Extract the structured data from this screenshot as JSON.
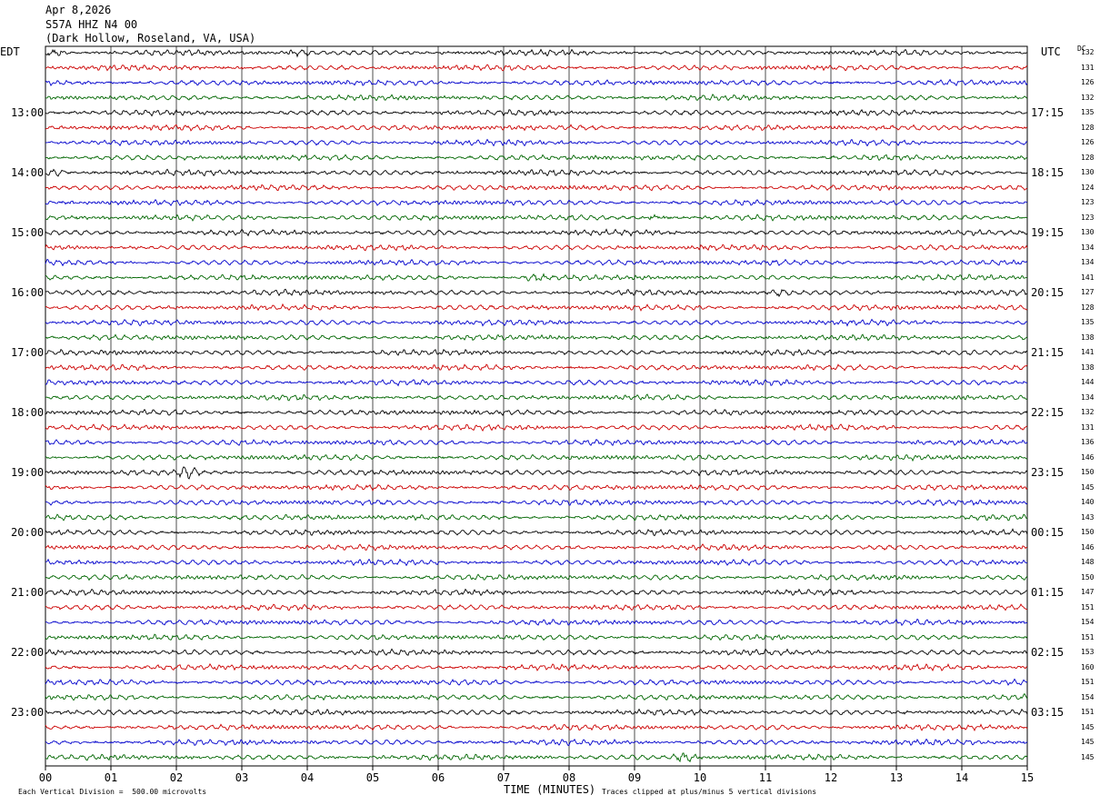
{
  "header": {
    "date": "Apr 8,2026",
    "station": "S57A HHZ N4 00",
    "location": "(Dark Hollow, Roseland, VA, USA)"
  },
  "labels": {
    "left_zone": "EDT",
    "right_zone": "UTC",
    "dc_label": "DC",
    "xlabel": "TIME (MINUTES)",
    "scale_note": "Each Vertical Division =  500.00 microvolts",
    "clip_note": "Traces clipped at plus/minus 5 vertical divisions"
  },
  "colors": {
    "trace_cycle": [
      "#000000",
      "#cc0000",
      "#0000cc",
      "#006600"
    ],
    "grid": "#000000",
    "background": "#ffffff"
  },
  "chart_data": {
    "type": "line",
    "description_kind": "helicorder",
    "x_ticks": [
      "00",
      "01",
      "02",
      "03",
      "04",
      "05",
      "06",
      "07",
      "08",
      "09",
      "10",
      "11",
      "12",
      "13",
      "14",
      "15"
    ],
    "xlim": [
      0,
      15
    ],
    "left_hour_labels": [
      "13:00",
      "14:00",
      "15:00",
      "16:00",
      "17:00",
      "18:00",
      "19:00",
      "20:00",
      "21:00",
      "22:00",
      "23:00"
    ],
    "right_hour_labels": [
      "17:15",
      "18:15",
      "19:15",
      "20:15",
      "21:15",
      "22:15",
      "23:15",
      "00:15",
      "01:15",
      "02:15",
      "03:15"
    ],
    "traces_count": 48,
    "dc_offsets": [
      132,
      131,
      126,
      132,
      135,
      128,
      126,
      128,
      130,
      124,
      123,
      123,
      130,
      134,
      134,
      141,
      127,
      128,
      135,
      138,
      141,
      138,
      144,
      134,
      132,
      131,
      136,
      146,
      150,
      145,
      140,
      143,
      150,
      146,
      148,
      150,
      147,
      151,
      154,
      151,
      153,
      160,
      151,
      154,
      151,
      145,
      145,
      145
    ],
    "events": [
      {
        "trace": 0,
        "minute": 0.15,
        "strength": 2.2
      },
      {
        "trace": 0,
        "minute": 3.9,
        "strength": 1.8
      },
      {
        "trace": 8,
        "minute": 0.2,
        "strength": 1.6
      },
      {
        "trace": 11,
        "minute": 9.3,
        "strength": 1.8
      },
      {
        "trace": 15,
        "minute": 7.45,
        "strength": 1.5
      },
      {
        "trace": 16,
        "minute": 11.2,
        "strength": 1.4
      },
      {
        "trace": 28,
        "minute": 2.2,
        "strength": 2.4
      },
      {
        "trace": 47,
        "minute": 9.8,
        "strength": 3.0
      }
    ]
  }
}
